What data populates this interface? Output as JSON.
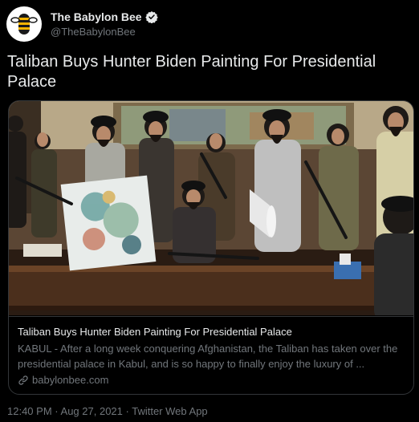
{
  "account": {
    "display_name": "The Babylon Bee",
    "handle": "@TheBabylonBee",
    "avatar_icon": "babylon-bee-logo",
    "verified_icon": "verified-badge-icon"
  },
  "tweet": {
    "text": "Taliban Buys Hunter Biden Painting For Presidential Palace"
  },
  "card": {
    "image_icon": "article-photo",
    "title": "Taliban Buys Hunter Biden Painting For Presidential Palace",
    "description": "KABUL - After a long week conquering Afghanistan, the Taliban has taken over the presidential palace in Kabul, and is so happy to finally enjoy the luxury of ...",
    "domain": "babylonbee.com",
    "domain_icon": "link-icon"
  },
  "meta": {
    "time": "12:40 PM",
    "date": "Aug 27, 2021",
    "source": "Twitter Web App",
    "separator": "·"
  },
  "colors": {
    "background": "#000000",
    "primary_text": "#e7e9ea",
    "secondary_text": "#71767b",
    "border": "#333639",
    "verified": "#1d9bf0"
  }
}
